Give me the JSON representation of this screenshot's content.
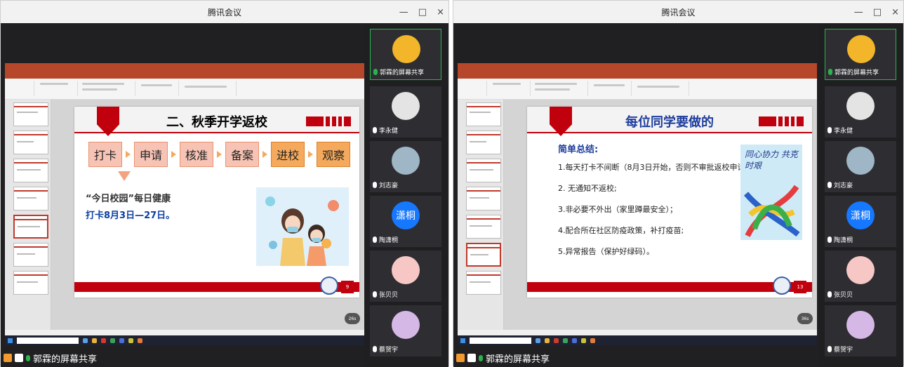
{
  "colors": {
    "accent": "#c0000d",
    "active_border": "#2bb24c",
    "avatar_blue": "#1677ff",
    "ppt_red": "#b7472a"
  },
  "left_window": {
    "title": "腾讯会议",
    "controls": [
      "—",
      "□",
      "×"
    ],
    "share_label": "郭霖的屏幕共享",
    "bubble": "26s",
    "slide": {
      "title": "二、秋季开学返校",
      "flow": [
        "打卡",
        "申请",
        "核准",
        "备案",
        "进校",
        "观察"
      ],
      "text1": "“今日校园”每日健康",
      "text2": "打卡8月3日—27日。",
      "number": "9"
    },
    "participants": [
      {
        "name": "郭霖的屏幕共享",
        "avatar": "avatar-image",
        "active": true
      },
      {
        "name": "李永健",
        "avatar": "avatar-image"
      },
      {
        "name": "刘志豪",
        "avatar": "avatar-image"
      },
      {
        "name": "陶潇桐",
        "avatar_text": "潇桐"
      },
      {
        "name": "张贝贝",
        "avatar": "avatar-image"
      },
      {
        "name": "蔡贺宇",
        "avatar": "avatar-image"
      }
    ]
  },
  "right_window": {
    "title": "腾讯会议",
    "controls": [
      "—",
      "□",
      "×"
    ],
    "share_label": "郭霖的屏幕共享",
    "bubble": "36s",
    "slide": {
      "title": "每位同学要做的",
      "subtitle": "简单总结:",
      "items": [
        "1.每天打卡不间断（8月3日开始，否则不审批返校申请）；",
        "2. 无通知不返校;",
        "3.非必要不外出（家里蹲最安全）；",
        "4.配合所在社区防疫政策，补打疫苗;",
        "5.异常报告（保护好绿码）。"
      ],
      "picture_text": "同心协力 共克时艰",
      "number": "13"
    },
    "participants": [
      {
        "name": "郭霖的屏幕共享",
        "avatar": "avatar-image",
        "active": true
      },
      {
        "name": "李永健",
        "avatar": "avatar-image"
      },
      {
        "name": "刘志豪",
        "avatar": "avatar-image"
      },
      {
        "name": "陶潇桐",
        "avatar_text": "潇桐"
      },
      {
        "name": "张贝贝",
        "avatar": "avatar-image"
      },
      {
        "name": "蔡贺宇",
        "avatar": "avatar-image"
      }
    ]
  }
}
